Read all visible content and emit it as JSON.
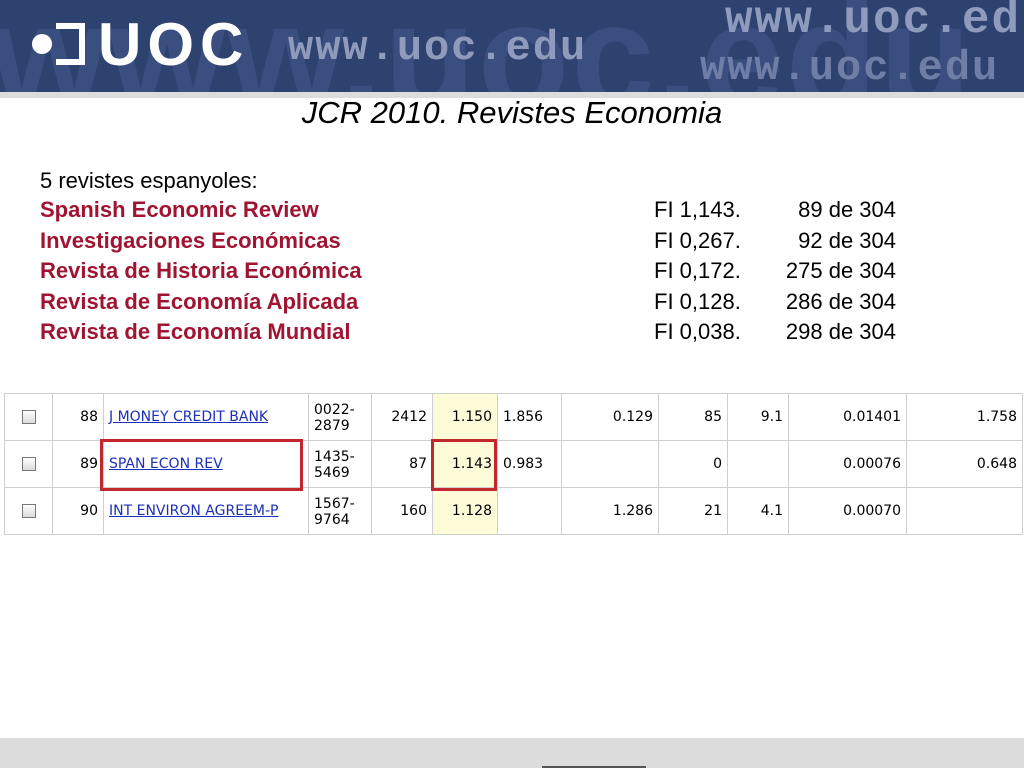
{
  "banner": {
    "logo_text": "UOC",
    "url": "www.uoc.edu",
    "ghost_text": "www.uoc.edu"
  },
  "title": "JCR 2010. Revistes Economia",
  "intro": "5 revistes espanyoles:",
  "journals": [
    {
      "name": "Spanish Economic Review",
      "fi": "FI 1,143.",
      "rank": "89 de 304"
    },
    {
      "name": "Investigaciones Económicas",
      "fi": "FI 0,267.",
      "rank": "92 de 304"
    },
    {
      "name": "Revista de Historia Económica",
      "fi": "FI 0,172.",
      "rank": "275 de 304"
    },
    {
      "name": "Revista de Economía Aplicada",
      "fi": "FI 0,128.",
      "rank": "286 de 304"
    },
    {
      "name": "Revista de Economía Mundial",
      "fi": "FI 0,038.",
      "rank": "298 de 304"
    }
  ],
  "jcr_table": {
    "rows": [
      {
        "rank": "88",
        "abbr": "J MONEY CREDIT BANK",
        "issn1": "0022-",
        "issn2": "2879",
        "cites": "2412",
        "if": "1.150",
        "if5": "1.856",
        "immediacy": "0.129",
        "articles": "85",
        "halflife": "9.1",
        "eigen": "0.01401",
        "ai": "1.758"
      },
      {
        "rank": "89",
        "abbr": "SPAN ECON REV",
        "issn1": "1435-",
        "issn2": "5469",
        "cites": "87",
        "if": "1.143",
        "if5": "0.983",
        "immediacy": "",
        "articles": "0",
        "halflife": "",
        "eigen": "0.00076",
        "ai": "0.648"
      },
      {
        "rank": "90",
        "abbr": "INT ENVIRON AGREEM-P",
        "issn1": "1567-",
        "issn2": "9764",
        "cites": "160",
        "if": "1.128",
        "if5": "",
        "immediacy": "1.286",
        "articles": "21",
        "halflife": "4.1",
        "eigen": "0.00070",
        "ai": ""
      }
    ]
  },
  "colors": {
    "banner": "#2e4270",
    "journal_name": "#a01432",
    "highlight_box": "#c1272d",
    "impact_column": "#fdfbd8",
    "link": "#1b2fb8"
  }
}
